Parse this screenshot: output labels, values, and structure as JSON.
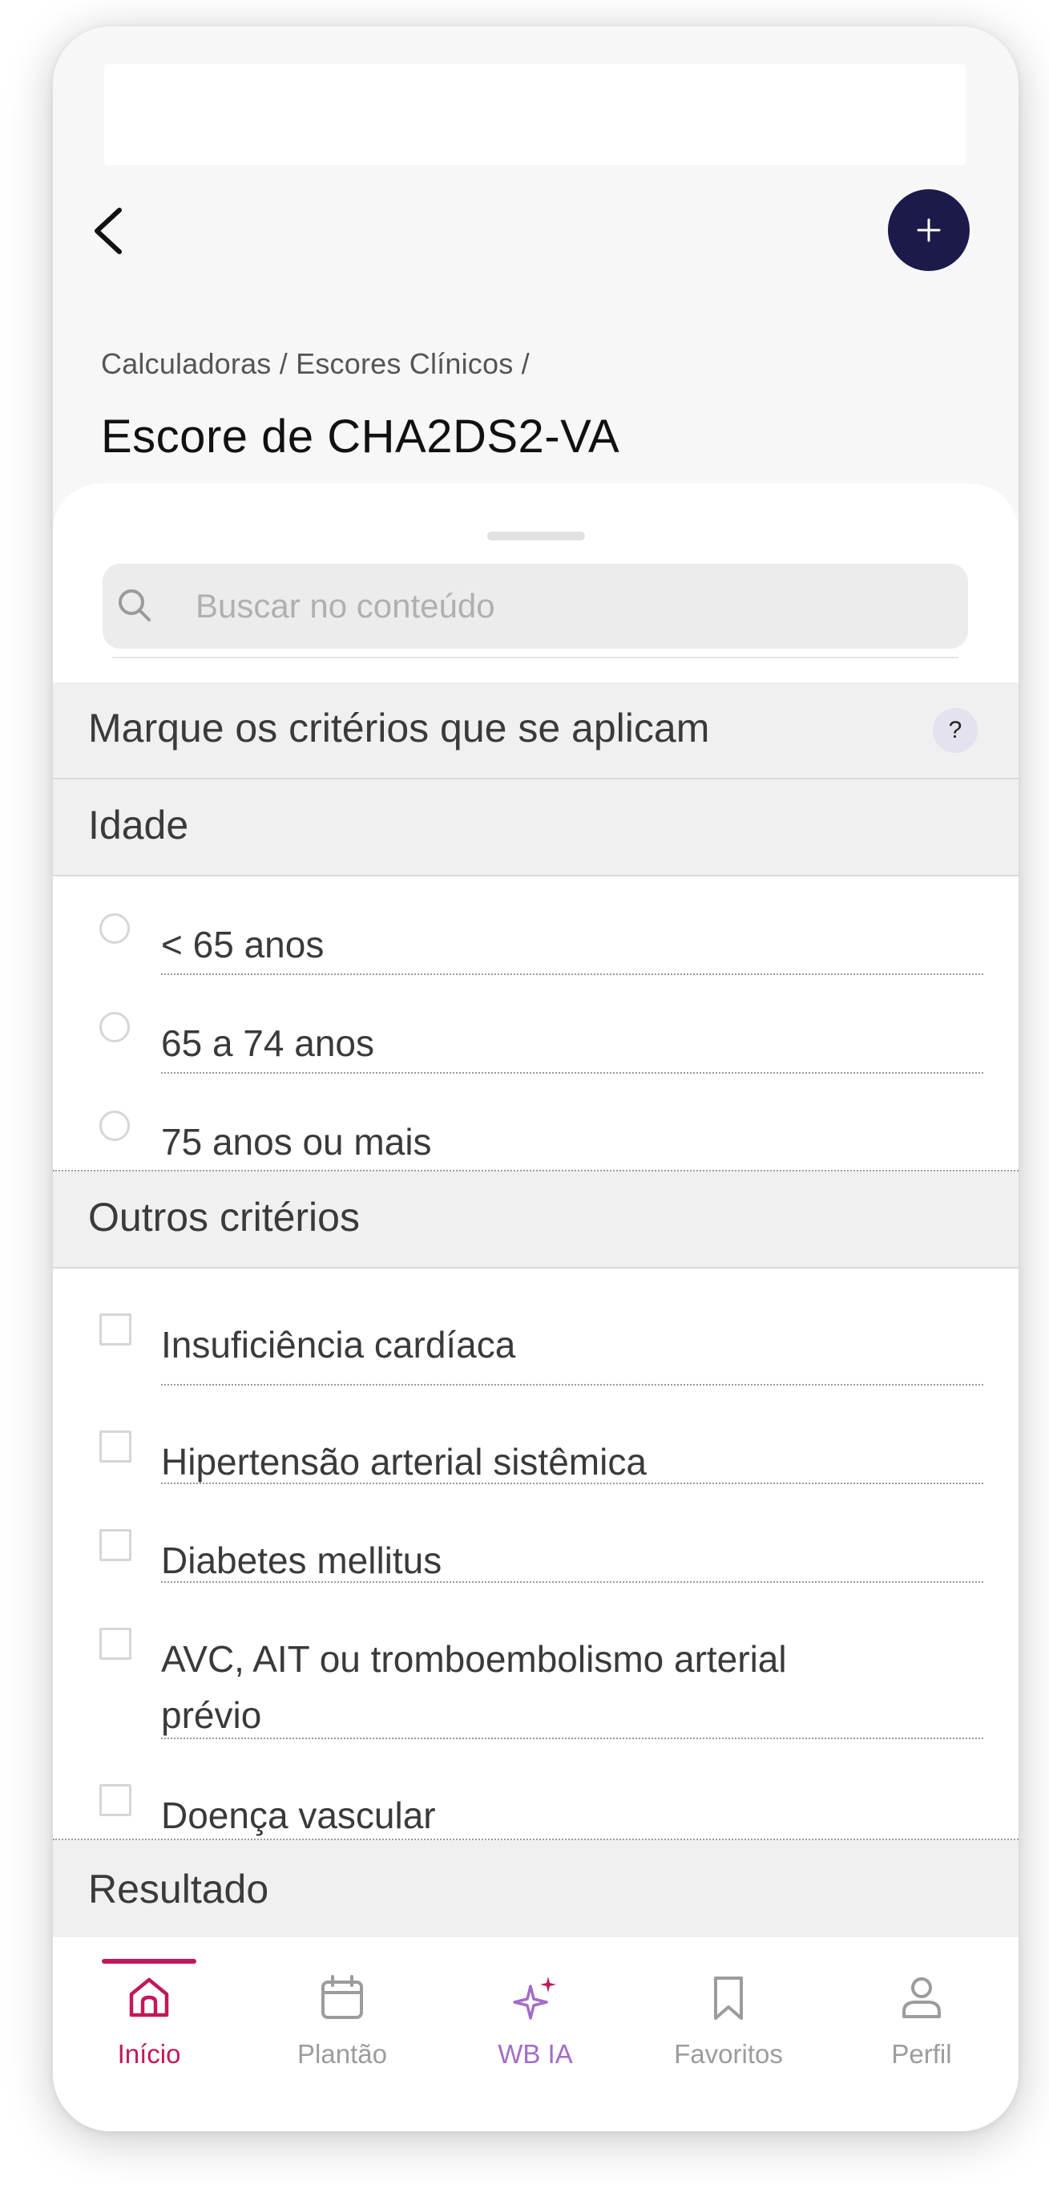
{
  "header": {
    "breadcrumb": "Calculadoras / Escores Clínicos /",
    "title": "Escore de CHA2DS2-VA",
    "add_icon": "plus-icon",
    "back_icon": "chevron-left-icon"
  },
  "search": {
    "placeholder": "Buscar no conteúdo"
  },
  "criteria_header": {
    "label": "Marque os critérios que se aplicam",
    "help": "?"
  },
  "age_section": {
    "title": "Idade",
    "options": [
      "< 65 anos",
      "65 a 74 anos",
      "75 anos ou mais"
    ]
  },
  "other_section": {
    "title": "Outros critérios",
    "options": [
      "Insuficiência cardíaca",
      "Hipertensão arterial sistêmica",
      "Diabetes mellitus",
      "AVC, AIT ou tromboembolismo arterial prévio",
      "Doença vascular"
    ]
  },
  "result_section": {
    "title": "Resultado"
  },
  "nav": {
    "items": [
      {
        "label": "Início",
        "icon": "home-icon",
        "active": true
      },
      {
        "label": "Plantão",
        "icon": "calendar-icon"
      },
      {
        "label": "WB IA",
        "icon": "sparkles-icon"
      },
      {
        "label": "Favoritos",
        "icon": "bookmark-icon"
      },
      {
        "label": "Perfil",
        "icon": "user-icon"
      }
    ]
  },
  "colors": {
    "accent": "#c2185b",
    "ai_purple": "#a46cc8",
    "inactive": "#9c9c9c",
    "add_button": "#1b1a4a"
  }
}
